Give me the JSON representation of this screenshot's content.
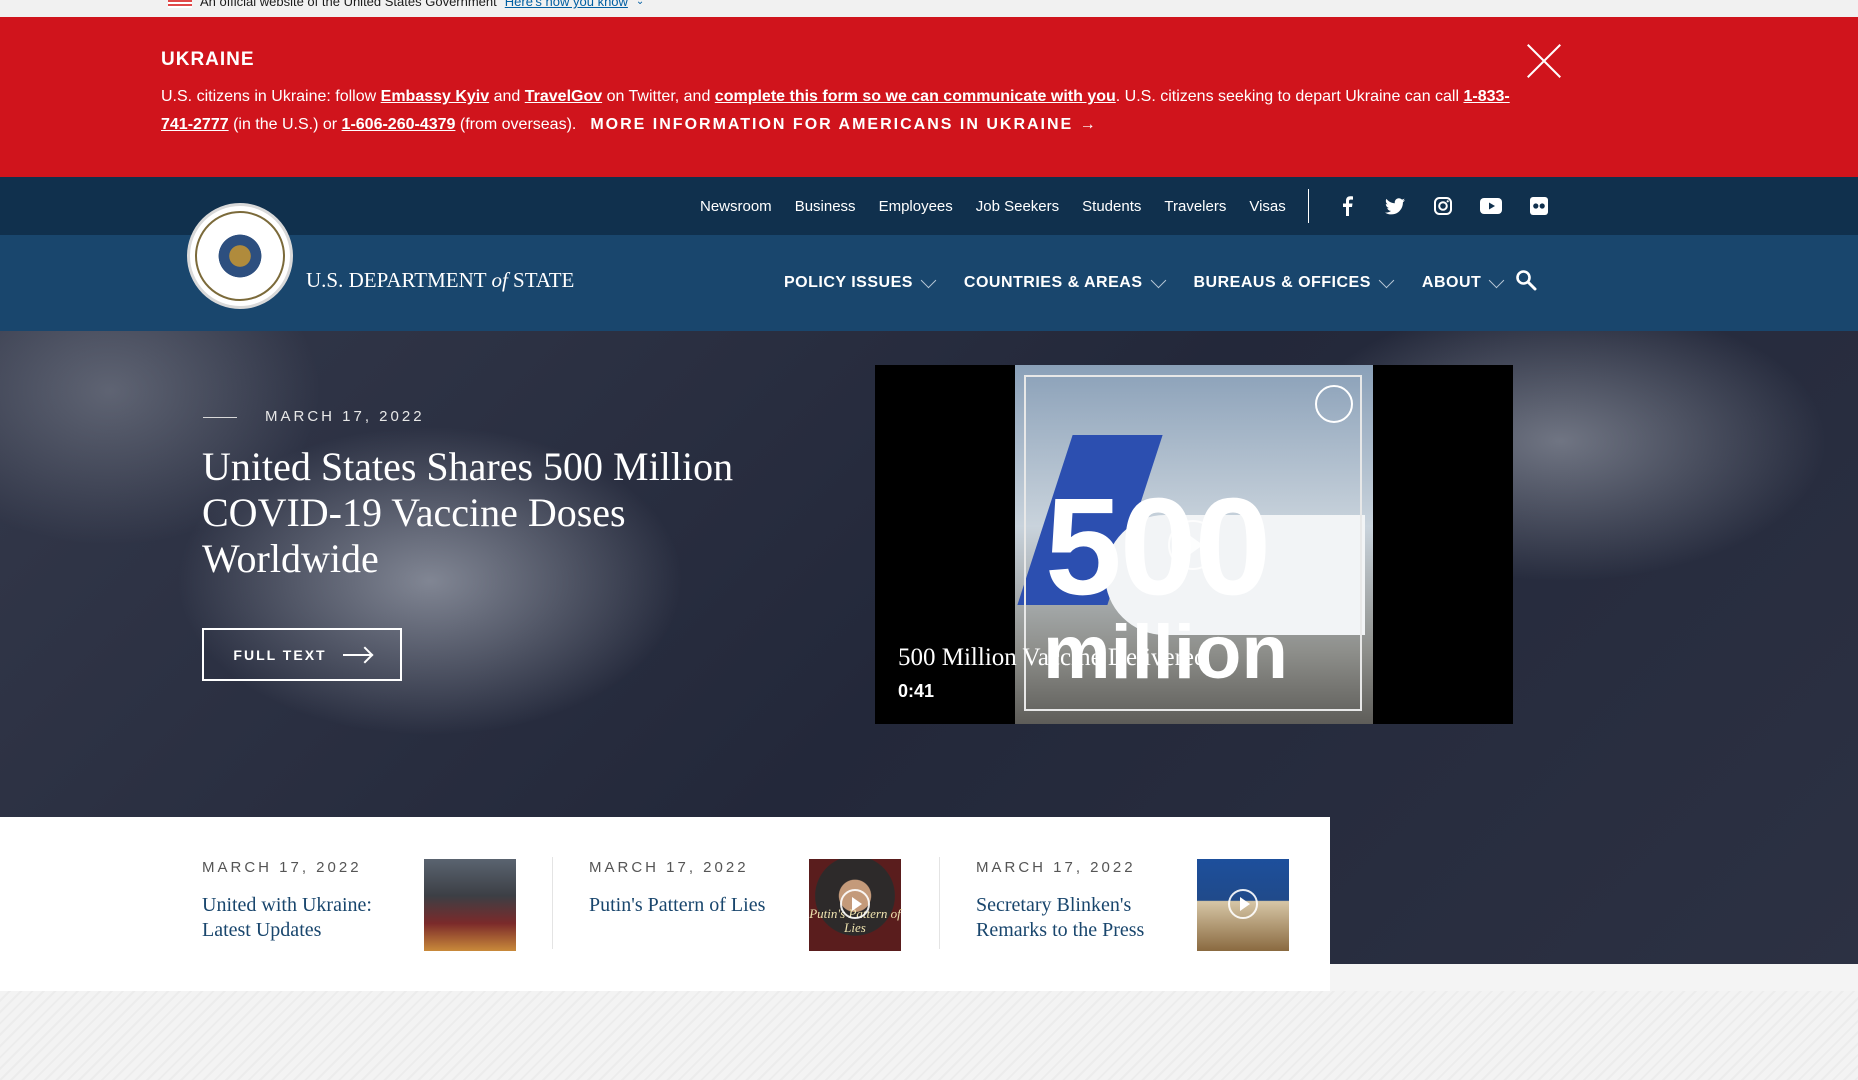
{
  "gov_banner": {
    "text": "An official website of the United States Government",
    "link": "Here's how you know"
  },
  "alert": {
    "title": "UKRAINE",
    "t1": "U.S. citizens in Ukraine: follow ",
    "l1": "Embassy Kyiv",
    "t2": " and ",
    "l2": "TravelGov",
    "t3": " on Twitter, and ",
    "l3": "complete this form so we can communicate with you",
    "t4": ". U.S. citizens seeking to depart Ukraine can call ",
    "l4": "1-833-741-2777",
    "t5": " (in the U.S.) or ",
    "l5": "1-606-260-4379",
    "t6": " (from overseas).",
    "more": "MORE INFORMATION FOR AMERICANS IN UKRAINE →"
  },
  "utility_nav": [
    "Newsroom",
    "Business",
    "Employees",
    "Job Seekers",
    "Students",
    "Travelers",
    "Visas"
  ],
  "social": [
    "facebook-icon",
    "twitter-icon",
    "instagram-icon",
    "youtube-icon",
    "flickr-icon"
  ],
  "logo": {
    "pre": "U.S. DEPARTMENT ",
    "of": "of",
    "post": " STATE"
  },
  "main_nav": [
    "POLICY ISSUES",
    "COUNTRIES & AREAS",
    "BUREAUS & OFFICES",
    "ABOUT"
  ],
  "hero": {
    "date": "MARCH 17, 2022",
    "title": "United States Shares 500 Million COVID-19 Vaccine Doses Worldwide",
    "button": "FULL TEXT",
    "video": {
      "title": "500 Million Vaccine Delivered",
      "duration": "0:41",
      "overlay_number": "500",
      "overlay_word": "million"
    }
  },
  "news": [
    {
      "date": "MARCH 17, 2022",
      "title": "United with Ukraine: Latest Updates"
    },
    {
      "date": "MARCH 17, 2022",
      "title": "Putin's Pattern of Lies",
      "caption": "Putin's Pattern of Lies"
    },
    {
      "date": "MARCH 17, 2022",
      "title": "Secretary Blinken's Remarks to the Press"
    }
  ],
  "colors": {
    "alert_red": "#d0141c",
    "nav_dark": "#10304d",
    "nav_blue": "#19466d"
  }
}
